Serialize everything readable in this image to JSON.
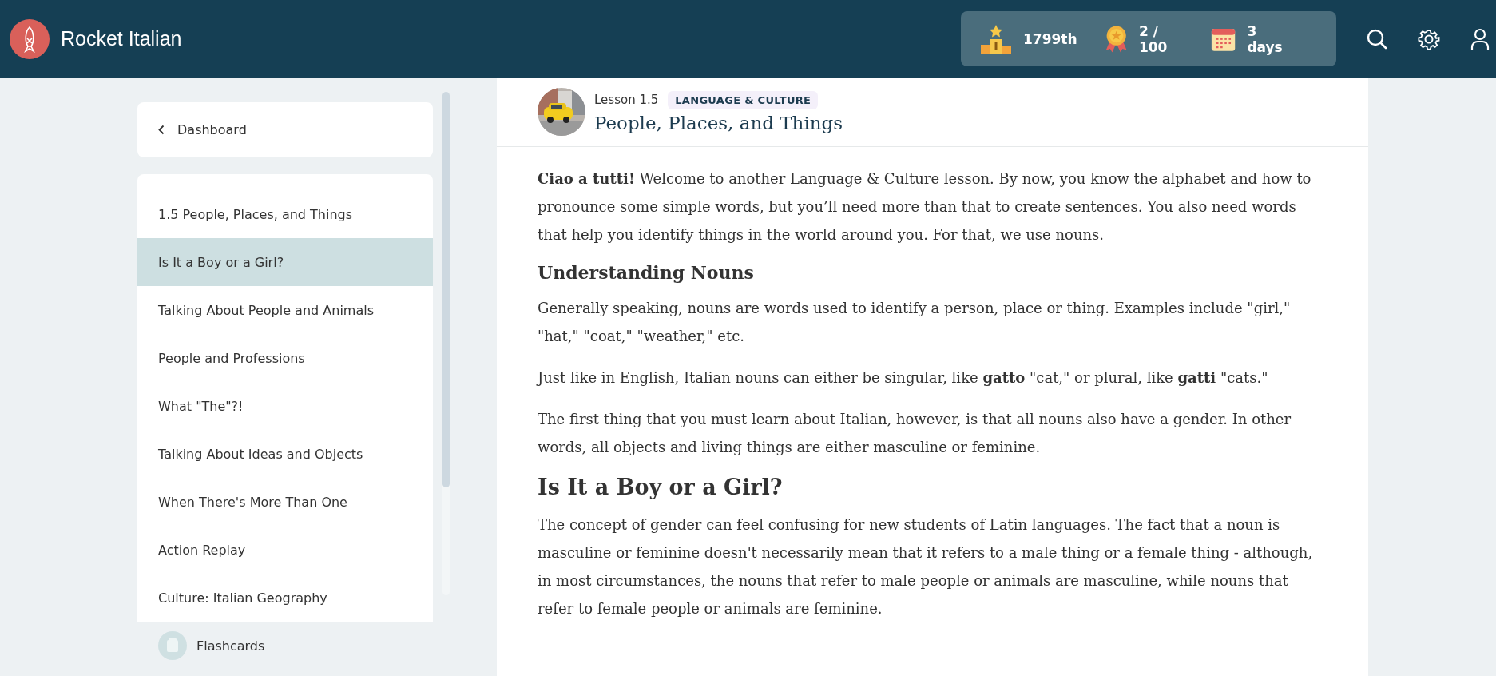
{
  "app": {
    "title": "Rocket Italian"
  },
  "stats": [
    {
      "kind": "rank",
      "value": "1799th"
    },
    {
      "kind": "medal",
      "value": "2 / 100"
    },
    {
      "kind": "streak",
      "value": "3 days"
    }
  ],
  "lesson": {
    "number": "Lesson 1.5",
    "tag": "LANGUAGE & CULTURE",
    "title": "People, Places, and Things"
  },
  "sidebar": {
    "back": "Dashboard",
    "items": [
      {
        "kind": "section",
        "label": "1.5 People, Places, and Things",
        "selected": false
      },
      {
        "kind": "section",
        "label": "Is It a Boy or a Girl?",
        "selected": true
      },
      {
        "kind": "section",
        "label": "Talking About People and Animals",
        "selected": false
      },
      {
        "kind": "section",
        "label": "People and Professions",
        "selected": false
      },
      {
        "kind": "section",
        "label": "What \"The\"?!",
        "selected": false
      },
      {
        "kind": "section",
        "label": "Talking About Ideas and Objects",
        "selected": false
      },
      {
        "kind": "section",
        "label": "When There's More Than One",
        "selected": false
      },
      {
        "kind": "section",
        "label": "Action Replay",
        "selected": false
      },
      {
        "kind": "section",
        "label": "Culture: Italian Geography",
        "selected": false
      },
      {
        "kind": "flashcards",
        "label": "Flashcards",
        "selected": false
      }
    ]
  },
  "article": [
    {
      "kind": "paragraph",
      "text": "**Ciao a tutti!** Welcome to another Language & Culture lesson. By now, you know the alphabet and how to pronounce some simple words, but you’ll need more than that to create sentences. You also need words that help you identify things in the world around you. For that, we use nouns."
    },
    {
      "kind": "subheading",
      "text": "Understanding Nouns"
    },
    {
      "kind": "paragraph",
      "text": "Generally speaking, nouns are words used to identify a person, place or thing. Examples include \"girl,\" \"hat,\" \"coat,\" \"weather,\" etc."
    },
    {
      "kind": "paragraph",
      "text": "Just like in English, Italian nouns can either be singular, like **gatto** \"cat,\" or plural, like **gatti** \"cats.\""
    },
    {
      "kind": "paragraph",
      "text": "The first thing that you must learn about Italian, however, is that all nouns also have a gender. In other words, all objects and living things are either masculine or feminine."
    },
    {
      "kind": "heading",
      "text": "Is It a Boy or a Girl?"
    },
    {
      "kind": "paragraph",
      "text": "The concept of gender can feel confusing for new students of Latin languages. The fact that a noun is masculine or feminine doesn't necessarily mean that it refers to a male thing or a female thing - although, in most circumstances, the nouns that refer to male people or animals are masculine, while nouns that refer to female people or animals are feminine."
    }
  ]
}
